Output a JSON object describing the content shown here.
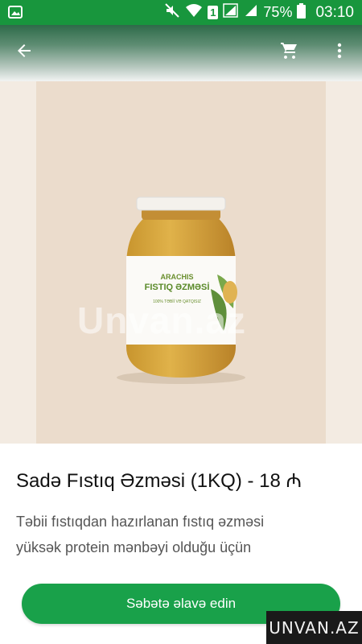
{
  "status_bar": {
    "battery_text": "75%",
    "time": "03:10",
    "sim_badge": "1"
  },
  "app_bar": {
    "back_icon": "arrow-left-icon",
    "cart_icon": "cart-icon",
    "menu_icon": "more-vert-icon"
  },
  "product": {
    "image_label_brand": "ARACHIS",
    "image_label_title": "FISTIQ ƏZMƏSİ",
    "image_label_sub": "100% TƏBİİ VƏ QATQISIZ",
    "watermark": "Unvan.az",
    "title": "Sadə Fıstıq Əzməsi (1KQ) - 18 ₼",
    "description_lines": [
      "Təbii fıstıqdan hazırlanan fıstıq əzməsi",
      "yüksək protein mənbəyi olduğu üçün"
    ]
  },
  "cta": {
    "add_to_cart": "Səbətə əlavə edin"
  },
  "corner_watermark": "UNVAN.AZ",
  "colors": {
    "primary_green": "#19a14a",
    "status_green": "#18963d"
  }
}
